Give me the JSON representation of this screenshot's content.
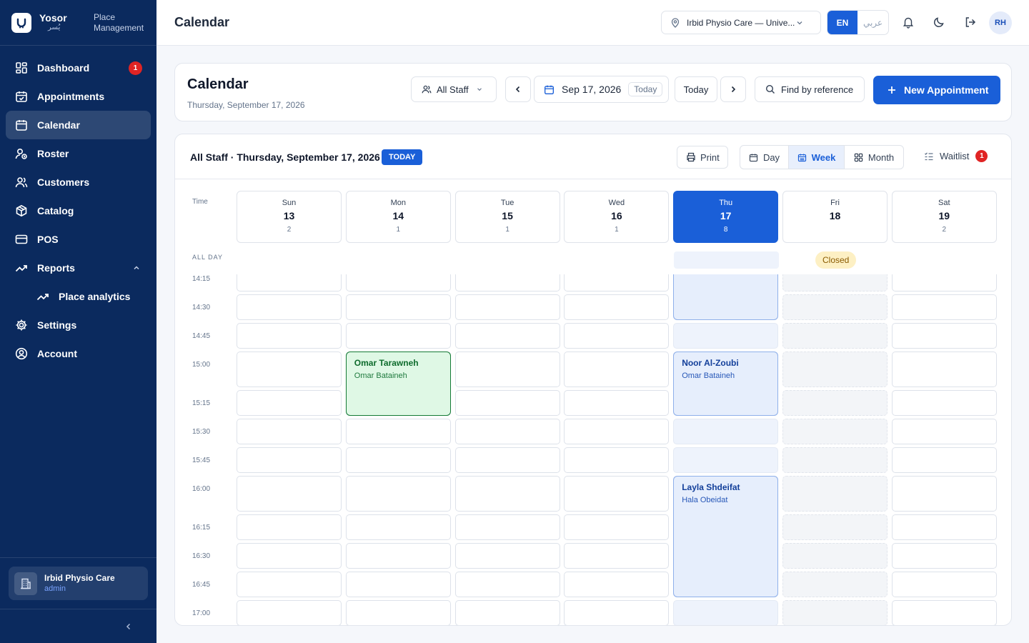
{
  "brand": {
    "name": "Yosor",
    "name_ar": "يُسر",
    "subtitle": "Place Management"
  },
  "sidebar": {
    "items": [
      {
        "label": "Dashboard",
        "icon": "grid-icon",
        "badge": "1"
      },
      {
        "label": "Appointments",
        "icon": "calendar-check-icon"
      },
      {
        "label": "Calendar",
        "icon": "calendar-icon",
        "active": true
      },
      {
        "label": "Roster",
        "icon": "user-clock-icon"
      },
      {
        "label": "Customers",
        "icon": "users-icon"
      },
      {
        "label": "Catalog",
        "icon": "box-icon"
      },
      {
        "label": "POS",
        "icon": "credit-card-icon"
      },
      {
        "label": "Reports",
        "icon": "trend-up-icon",
        "expanded": true
      },
      {
        "label": "Place analytics",
        "icon": "trend-up-icon",
        "sub": true
      },
      {
        "label": "Settings",
        "icon": "gear-icon"
      },
      {
        "label": "Account",
        "icon": "user-circle-icon"
      }
    ],
    "place": {
      "name": "Irbid Physio Care",
      "role": "admin"
    }
  },
  "topbar": {
    "title": "Calendar",
    "location": "Irbid Physio Care — Unive...",
    "lang_en": "EN",
    "lang_ar": "عربي",
    "avatar": "RH"
  },
  "header": {
    "title": "Calendar",
    "subtitle": "Thursday, September 17, 2026",
    "staff_filter": "All Staff",
    "date": "Sep 17, 2026",
    "date_pill": "Today",
    "today_btn": "Today",
    "find_btn": "Find by reference",
    "new_btn": "New Appointment"
  },
  "calendar": {
    "label": "All Staff · Thursday, September 17, 2026",
    "today_badge": "TODAY",
    "print": "Print",
    "views": [
      "Day",
      "Week",
      "Month"
    ],
    "active_view": "Week",
    "waitlist": "Waitlist",
    "waitlist_count": "1",
    "time_header": "Time",
    "all_day": "ALL DAY",
    "closed_label": "Closed",
    "days": [
      {
        "name": "Sun",
        "date": "13",
        "count": "2"
      },
      {
        "name": "Mon",
        "date": "14",
        "count": "1"
      },
      {
        "name": "Tue",
        "date": "15",
        "count": "1"
      },
      {
        "name": "Wed",
        "date": "16",
        "count": "1"
      },
      {
        "name": "Thu",
        "date": "17",
        "count": "8",
        "today": true
      },
      {
        "name": "Fri",
        "date": "18",
        "count": "",
        "closed": true
      },
      {
        "name": "Sat",
        "date": "19",
        "count": "2"
      }
    ],
    "times": [
      "14:15",
      "14:30",
      "14:45",
      "15:00",
      "15:15",
      "15:30",
      "15:45",
      "16:00",
      "16:15",
      "16:30",
      "16:45",
      "17:00"
    ],
    "appointments": [
      {
        "customer": "Omar Tarawneh",
        "staff": "Omar Bataineh",
        "day": 1,
        "start": "15:00",
        "slots": 2,
        "color": "green"
      },
      {
        "customer": "Noor Al-Zoubi",
        "staff": "Omar Bataineh",
        "day": 4,
        "start": "15:00",
        "slots": 2,
        "color": "blue"
      },
      {
        "customer": "Layla Shdeifat",
        "staff": "Hala Obeidat",
        "day": 4,
        "start": "16:00",
        "slots": 4,
        "color": "blue"
      }
    ]
  },
  "colors": {
    "sidebar": "#0b2a5e",
    "primary": "#1a5fd8",
    "badge": "#e02424"
  }
}
